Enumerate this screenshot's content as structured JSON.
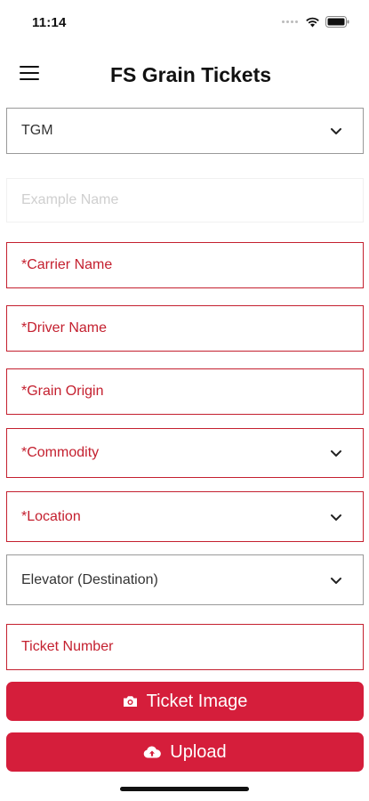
{
  "status_bar": {
    "time": "11:14"
  },
  "header": {
    "title": "FS Grain Tickets",
    "menu_icon": "hamburger-menu-icon"
  },
  "form": {
    "company": {
      "value": "TGM"
    },
    "example_name": {
      "placeholder": "Example Name"
    },
    "carrier_name": {
      "placeholder": "*Carrier Name"
    },
    "driver_name": {
      "placeholder": "*Driver Name"
    },
    "grain_origin": {
      "placeholder": "*Grain Origin"
    },
    "commodity": {
      "placeholder": "*Commodity"
    },
    "location": {
      "placeholder": "*Location"
    },
    "elevator": {
      "placeholder": "Elevator (Destination)"
    },
    "ticket_number": {
      "placeholder": "Ticket Number"
    }
  },
  "buttons": {
    "ticket_image": {
      "label": "Ticket Image",
      "icon": "camera-icon"
    },
    "upload": {
      "label": "Upload",
      "icon": "cloud-upload-icon"
    }
  },
  "colors": {
    "accent": "#d51e3b",
    "required_border": "#c4202f"
  }
}
